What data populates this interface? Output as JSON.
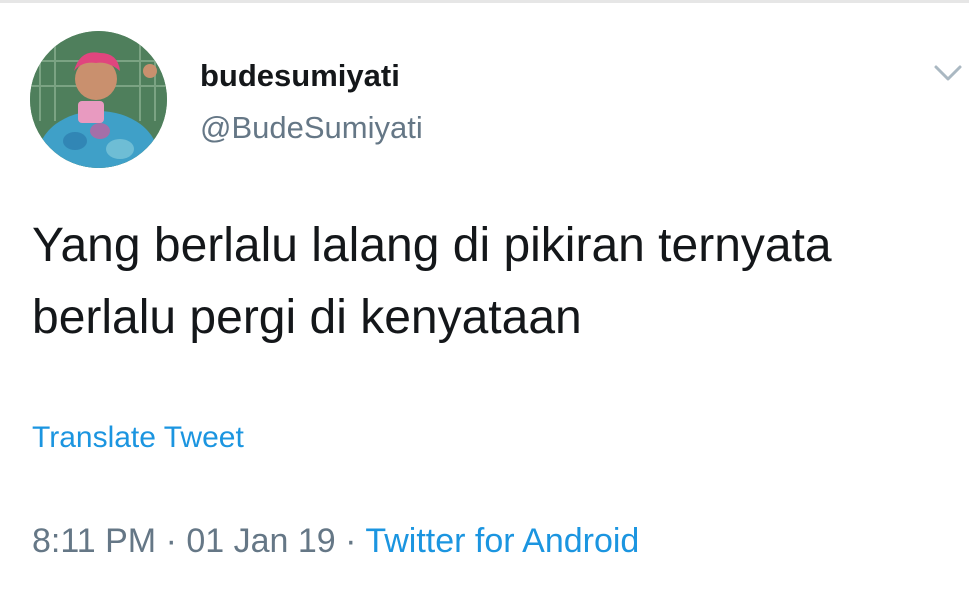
{
  "user": {
    "display_name": "budesumiyati",
    "handle": "@BudeSumiyati",
    "avatar_icon": "profile-photo-avatar"
  },
  "tweet": {
    "text_lines": [
      "Yang berlalu lalang di pikiran ternyata",
      "berlalu pergi di kenyataan"
    ],
    "translate_label": "Translate Tweet",
    "time": "8:11 PM",
    "separator": "·",
    "date": "01 Jan 19",
    "source": "Twitter for Android"
  },
  "icons": {
    "menu": "chevron-down-icon"
  },
  "colors": {
    "text": "#14171a",
    "muted": "#657786",
    "link": "#1b95e0",
    "background": "#ffffff"
  }
}
